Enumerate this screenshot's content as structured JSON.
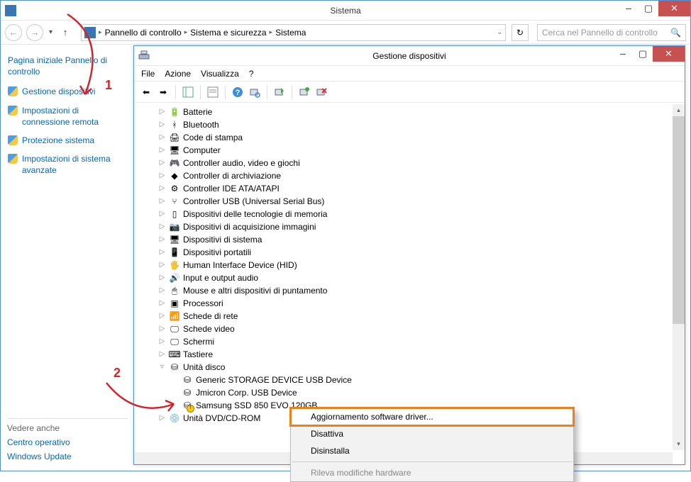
{
  "outer": {
    "title": "Sistema",
    "breadcrumbs": [
      "Pannello di controllo",
      "Sistema e sicurezza",
      "Sistema"
    ],
    "search_placeholder": "Cerca nel Pannello di controllo"
  },
  "sidebar": {
    "home": "Pagina iniziale Pannello di controllo",
    "tasks": [
      "Gestione dispositivi",
      "Impostazioni di connessione remota",
      "Protezione sistema",
      "Impostazioni di sistema avanzate"
    ],
    "see_also_header": "Vedere anche",
    "see_also": [
      "Centro operativo",
      "Windows Update"
    ]
  },
  "inner": {
    "title": "Gestione dispositivi",
    "menu": [
      "File",
      "Azione",
      "Visualizza",
      "?"
    ]
  },
  "tree": [
    {
      "d": 1,
      "exp": "▷",
      "icon": "battery",
      "label": "Batterie"
    },
    {
      "d": 1,
      "exp": "▷",
      "icon": "bluetooth",
      "label": "Bluetooth"
    },
    {
      "d": 1,
      "exp": "▷",
      "icon": "printer",
      "label": "Code di stampa"
    },
    {
      "d": 1,
      "exp": "▷",
      "icon": "computer",
      "label": "Computer"
    },
    {
      "d": 1,
      "exp": "▷",
      "icon": "gamectrl",
      "label": "Controller audio, video e giochi"
    },
    {
      "d": 1,
      "exp": "▷",
      "icon": "storage",
      "label": "Controller di archiviazione"
    },
    {
      "d": 1,
      "exp": "▷",
      "icon": "ide",
      "label": "Controller IDE ATA/ATAPI"
    },
    {
      "d": 1,
      "exp": "▷",
      "icon": "usb",
      "label": "Controller USB (Universal Serial Bus)"
    },
    {
      "d": 1,
      "exp": "▷",
      "icon": "memory",
      "label": "Dispositivi delle tecnologie di memoria"
    },
    {
      "d": 1,
      "exp": "▷",
      "icon": "camera",
      "label": "Dispositivi di acquisizione immagini"
    },
    {
      "d": 1,
      "exp": "▷",
      "icon": "system",
      "label": "Dispositivi di sistema"
    },
    {
      "d": 1,
      "exp": "▷",
      "icon": "portable",
      "label": "Dispositivi portatili"
    },
    {
      "d": 1,
      "exp": "▷",
      "icon": "hid",
      "label": "Human Interface Device (HID)"
    },
    {
      "d": 1,
      "exp": "▷",
      "icon": "audio",
      "label": "Input e output audio"
    },
    {
      "d": 1,
      "exp": "▷",
      "icon": "mouse",
      "label": "Mouse e altri dispositivi di puntamento"
    },
    {
      "d": 1,
      "exp": "▷",
      "icon": "cpu",
      "label": "Processori"
    },
    {
      "d": 1,
      "exp": "▷",
      "icon": "network",
      "label": "Schede di rete"
    },
    {
      "d": 1,
      "exp": "▷",
      "icon": "display",
      "label": "Schede video"
    },
    {
      "d": 1,
      "exp": "▷",
      "icon": "monitor",
      "label": "Schermi"
    },
    {
      "d": 1,
      "exp": "▷",
      "icon": "keyboard",
      "label": "Tastiere"
    },
    {
      "d": 1,
      "exp": "▿",
      "icon": "disk",
      "label": "Unità disco"
    },
    {
      "d": 2,
      "exp": "",
      "icon": "disk",
      "label": "Generic STORAGE DEVICE USB Device"
    },
    {
      "d": 2,
      "exp": "",
      "icon": "disk",
      "label": "Jmicron Corp. USB Device"
    },
    {
      "d": 2,
      "exp": "",
      "icon": "disk",
      "label": "Samsung SSD 850 EVO 120GB",
      "warn": true
    },
    {
      "d": 1,
      "exp": "▷",
      "icon": "dvd",
      "label": "Unità DVD/CD-ROM"
    }
  ],
  "context_menu": [
    "Aggiornamento software driver...",
    "Disattiva",
    "Disinstalla",
    "Rileva modifiche hardware"
  ],
  "annotations": {
    "a1": "1",
    "a2": "2"
  }
}
